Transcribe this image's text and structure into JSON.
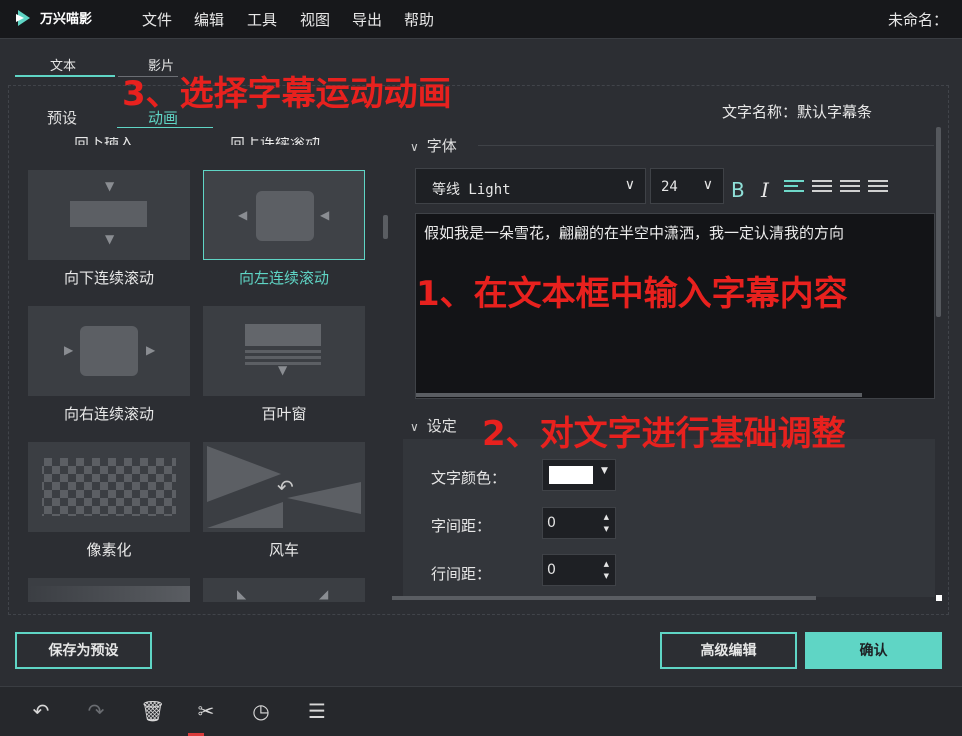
{
  "app": {
    "name": "万兴喵影",
    "document": "未命名："
  },
  "menu": [
    "文件",
    "编辑",
    "工具",
    "视图",
    "导出",
    "帮助"
  ],
  "top_tabs": [
    "文本",
    "影片"
  ],
  "sub_tabs": [
    "预设",
    "动画"
  ],
  "animations": {
    "cut_labels": [
      "向下插入",
      "向上连续滚动"
    ],
    "items": [
      "向下连续滚动",
      "向左连续滚动",
      "向右连续滚动",
      "百叶窗",
      "像素化",
      "风车"
    ],
    "selected": "向左连续滚动"
  },
  "subtitle_name": "文字名称：默认字幕条",
  "font_section": {
    "title": "字体",
    "font_family": "等线 Light",
    "font_size": "24",
    "bold": "B",
    "italic": "I"
  },
  "text_content": "假如我是一朵雪花，翩翩的在半空中潇洒，我一定认清我的方向",
  "settings": {
    "title": "设定",
    "color_label": "文字颜色：",
    "color_value": "#ffffff",
    "char_spacing_label": "字间距：",
    "char_spacing": "0",
    "line_spacing_label": "行间距：",
    "line_spacing": "0"
  },
  "buttons": {
    "save_preset": "保存为预设",
    "advanced": "高级编辑",
    "confirm": "确认"
  },
  "annotations": {
    "step1": "1、在文本框中输入字幕内容",
    "step2": "2、对文字进行基础调整",
    "step3": "3、选择字幕运动动画"
  },
  "toolbar_icons": [
    "undo-icon",
    "redo-icon",
    "delete-icon",
    "cut-icon",
    "clock-icon",
    "adjust-icon"
  ],
  "colors": {
    "accent": "#5fd5c5",
    "annotation": "#e8211e"
  }
}
